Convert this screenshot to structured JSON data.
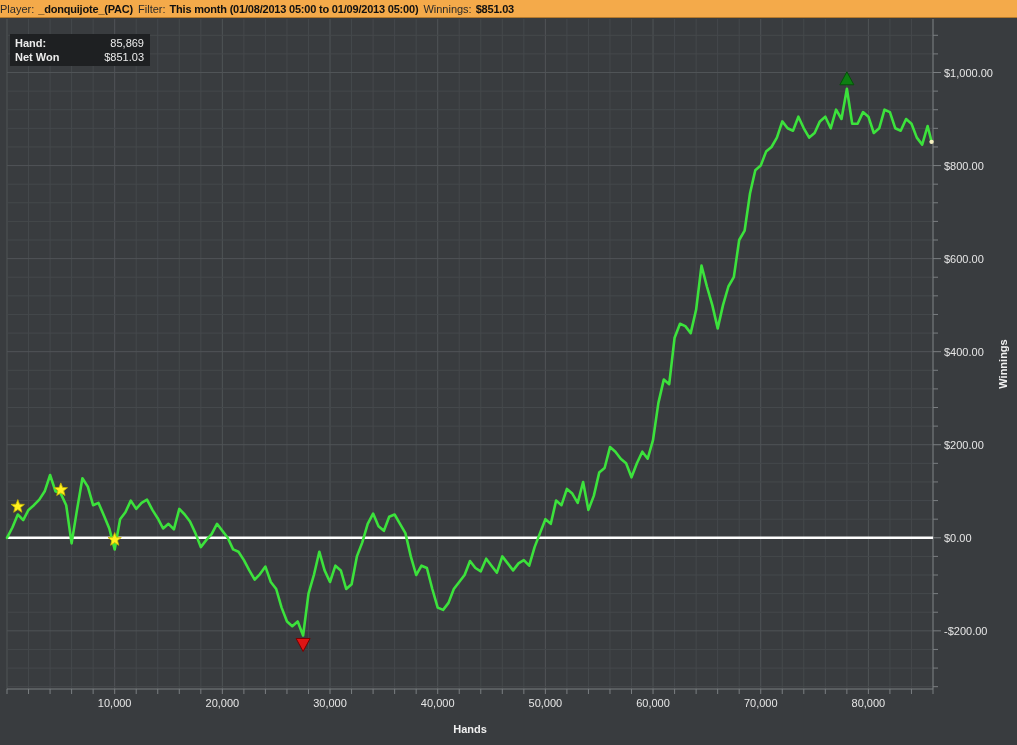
{
  "filter_bar": [
    {
      "label": "Player:",
      "value": "_donquijote_(PAC)"
    },
    {
      "label": "Filter:",
      "value": "This month (01/08/2013 05:00 to 01/09/2013 05:00)"
    },
    {
      "label": "Winnings:",
      "value": "$851.03"
    }
  ],
  "chart": {
    "readout": [
      {
        "label": "Hand:",
        "value": "85,869"
      },
      {
        "label": "Net Won",
        "value": "$851.03"
      }
    ],
    "chart_data": {
      "type": "line",
      "xlabel": "Hands",
      "ylabel": "Winnings",
      "grid": true,
      "x": [
        0,
        500,
        1000,
        1500,
        2000,
        2500,
        3000,
        3500,
        4000,
        4500,
        5000,
        5500,
        6000,
        6500,
        7000,
        7500,
        8000,
        8500,
        9000,
        9500,
        10000,
        10500,
        11000,
        11500,
        12000,
        12500,
        13000,
        13500,
        14000,
        14500,
        15000,
        15500,
        16000,
        16500,
        17000,
        17500,
        18000,
        18500,
        19000,
        19500,
        20000,
        20500,
        21000,
        21500,
        22000,
        22500,
        23000,
        23500,
        24000,
        24500,
        25000,
        25500,
        26000,
        26500,
        27000,
        27500,
        28000,
        28500,
        29000,
        29500,
        30000,
        30500,
        31000,
        31500,
        32000,
        32500,
        33000,
        33500,
        34000,
        34500,
        35000,
        35500,
        36000,
        36500,
        37000,
        37500,
        38000,
        38500,
        39000,
        39500,
        40000,
        40500,
        41000,
        41500,
        42000,
        42500,
        43000,
        43500,
        44000,
        44500,
        45000,
        45500,
        46000,
        46500,
        47000,
        47500,
        48000,
        48500,
        49000,
        49500,
        50000,
        50500,
        51000,
        51500,
        52000,
        52500,
        53000,
        53500,
        54000,
        54500,
        55000,
        55500,
        56000,
        56500,
        57000,
        57500,
        58000,
        58500,
        59000,
        59500,
        60000,
        60500,
        61000,
        61500,
        62000,
        62500,
        63000,
        63500,
        64000,
        64500,
        65000,
        65500,
        66000,
        66500,
        67000,
        67500,
        68000,
        68500,
        69000,
        69500,
        70000,
        70500,
        71000,
        71500,
        72000,
        72500,
        73000,
        73500,
        74000,
        74500,
        75000,
        75500,
        76000,
        76500,
        77000,
        77500,
        78000,
        78500,
        79000,
        79500,
        80000,
        80500,
        81000,
        81500,
        82000,
        82500,
        83000,
        83500,
        84000,
        84500,
        85000,
        85500,
        85869
      ],
      "series": [
        {
          "color": "#3ce23c",
          "values": [
            0,
            22,
            50,
            38,
            60,
            70,
            82,
            100,
            135,
            100,
            95,
            70,
            -12,
            60,
            128,
            110,
            70,
            75,
            48,
            20,
            -25,
            40,
            55,
            80,
            62,
            75,
            82,
            60,
            42,
            20,
            30,
            18,
            62,
            50,
            35,
            10,
            -20,
            -5,
            8,
            30,
            15,
            0,
            -25,
            -30,
            -48,
            -70,
            -90,
            -78,
            -62,
            -95,
            -110,
            -150,
            -180,
            -190,
            -180,
            -210,
            -120,
            -80,
            -30,
            -70,
            -95,
            -60,
            -70,
            -110,
            -100,
            -40,
            -10,
            30,
            52,
            25,
            15,
            45,
            50,
            30,
            10,
            -40,
            -80,
            -60,
            -65,
            -110,
            -150,
            -155,
            -140,
            -110,
            -95,
            -80,
            -50,
            -65,
            -72,
            -45,
            -60,
            -75,
            -40,
            -55,
            -70,
            -55,
            -48,
            -60,
            -20,
            10,
            40,
            30,
            80,
            70,
            105,
            95,
            75,
            120,
            60,
            90,
            140,
            150,
            195,
            185,
            170,
            160,
            130,
            160,
            185,
            170,
            210,
            290,
            340,
            330,
            430,
            460,
            455,
            440,
            490,
            585,
            540,
            500,
            450,
            500,
            540,
            560,
            640,
            660,
            740,
            790,
            800,
            830,
            840,
            860,
            895,
            880,
            875,
            905,
            880,
            860,
            870,
            895,
            905,
            880,
            920,
            900,
            965,
            890,
            890,
            915,
            905,
            870,
            880,
            920,
            915,
            880,
            875,
            900,
            890,
            860,
            845,
            885,
            851
          ]
        },
        {
          "type": "scatter",
          "color": "#fff01e",
          "values": [
            null,
            null,
            67,
            null,
            null,
            null,
            null,
            null,
            null,
            null,
            103,
            null,
            null,
            null,
            null,
            null,
            null,
            null,
            null,
            null,
            -4,
            null,
            null,
            null,
            null,
            null,
            null,
            null,
            null,
            null,
            null,
            null,
            null,
            null,
            null,
            null,
            null,
            null,
            null,
            null,
            null,
            null,
            null,
            null,
            null,
            null,
            null,
            null,
            null,
            null,
            null,
            null,
            null,
            null,
            null,
            null,
            null,
            null,
            null,
            null,
            null,
            null,
            null,
            null,
            null,
            null,
            null,
            null,
            null,
            null,
            null,
            null,
            null,
            null,
            null,
            null,
            null,
            null,
            null,
            null,
            null,
            null,
            null,
            null,
            null,
            null,
            null,
            null,
            null,
            null,
            null,
            null,
            null,
            null,
            null,
            null,
            null,
            null,
            null,
            null,
            null,
            null,
            null,
            null,
            null,
            null,
            null,
            null,
            null,
            null,
            null,
            null,
            null,
            null,
            null,
            null,
            null,
            null,
            null,
            null,
            null,
            null,
            null,
            null,
            null,
            null,
            null,
            null,
            null,
            null,
            null,
            null,
            null,
            null,
            null,
            null,
            null,
            null,
            null,
            null,
            null,
            null,
            null,
            null,
            null,
            null,
            null,
            null,
            null,
            null,
            null,
            null,
            null,
            null,
            null,
            null,
            null,
            null,
            null,
            null,
            null,
            null,
            null,
            null,
            null,
            null,
            null,
            null,
            null,
            null,
            null,
            null,
            null
          ]
        }
      ],
      "xlim": [
        0,
        86000
      ],
      "ylim": [
        -325,
        1115
      ],
      "xticks": [
        {
          "value": 10000,
          "label": "10,000"
        },
        {
          "value": 20000,
          "label": "20,000"
        },
        {
          "value": 30000,
          "label": "30,000"
        },
        {
          "value": 40000,
          "label": "40,000"
        },
        {
          "value": 50000,
          "label": "50,000"
        },
        {
          "value": 60000,
          "label": "60,000"
        },
        {
          "value": 70000,
          "label": "70,000"
        },
        {
          "value": 80000,
          "label": "80,000"
        }
      ],
      "yticks": [
        {
          "value": -200,
          "label": "-$200.00"
        },
        {
          "value": 0,
          "label": "$0.00"
        },
        {
          "value": 200,
          "label": "$200.00"
        },
        {
          "value": 400,
          "label": "$400.00"
        },
        {
          "value": 600,
          "label": "$600.00"
        },
        {
          "value": 800,
          "label": "$800.00"
        },
        {
          "value": 1000,
          "label": "$1,000.00"
        }
      ],
      "ref_lines": [
        {
          "axis": "y",
          "value": 0
        }
      ]
    }
  }
}
